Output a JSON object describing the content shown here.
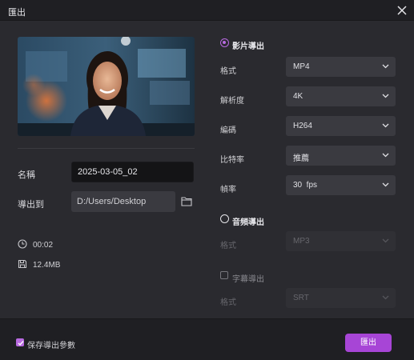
{
  "window": {
    "title": "匯出"
  },
  "video": {
    "name_label": "名稱",
    "name_value": "2025-03-05_02",
    "export_to_label": "導出到",
    "path": "D:/Users/Desktop",
    "duration": "00:02",
    "size": "12.4MB"
  },
  "video_export": {
    "title": "影片導出",
    "format_label": "格式",
    "format_value": "MP4",
    "resolution_label": "解析度",
    "resolution_value": "4K",
    "codec_label": "編碼",
    "codec_value": "H264",
    "bitrate_label": "比特率",
    "bitrate_value": "推薦",
    "framerate_label": "幀率",
    "framerate_value": "30  fps"
  },
  "audio_export": {
    "title": "音頻導出",
    "format_label": "格式",
    "format_value": "MP3"
  },
  "subtitle_export": {
    "title": "字幕導出",
    "format_label": "格式",
    "format_value": "SRT"
  },
  "footer": {
    "save_params_label": "保存導出參數",
    "export_button": "匯出"
  },
  "colors": {
    "accent": "#a745d6",
    "background": "#2a2a2f",
    "titlebar": "#1f1f23"
  }
}
